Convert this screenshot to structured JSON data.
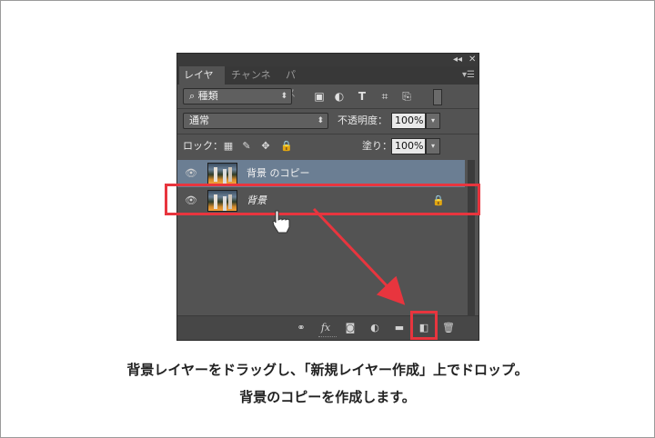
{
  "panel": {
    "top_controls": [
      "◂◂",
      "✕"
    ],
    "tabs": [
      {
        "label": "レイヤー",
        "active": true
      },
      {
        "label": "チャンネル",
        "active": false
      },
      {
        "label": "パス",
        "active": false
      }
    ],
    "menu_icon": "panel-menu-icon",
    "filter": {
      "label": "種類",
      "search_icon": "⌕"
    },
    "filter_icons": [
      "image-filter-icon",
      "adjustment-filter-icon",
      "text-filter-icon",
      "shape-filter-icon",
      "smart-object-filter-icon",
      "filter-toggle-icon"
    ],
    "blend": {
      "mode": "通常",
      "opacity_label": "不透明度：",
      "opacity": "100%"
    },
    "lock": {
      "label": "ロック：",
      "fill_label": "塗り：",
      "fill": "100%"
    },
    "layers": [
      {
        "name": "背景 のコピー",
        "selected": true,
        "italic": false,
        "locked": false
      },
      {
        "name": "背景",
        "selected": false,
        "italic": true,
        "locked": true
      }
    ],
    "footer_icons": [
      "link-icon",
      "fx-icon",
      "mask-icon",
      "adjustment-icon",
      "folder-icon",
      "new-layer-icon",
      "trash-icon"
    ],
    "footer_text": {
      "fx": "fx"
    }
  },
  "caption": {
    "line1": "背景レイヤーをドラッグし、「新規レイヤー作成」上でドロップ。",
    "line2": "背景のコピーを作成します。"
  },
  "colors": {
    "accent_red": "#e8353e",
    "selected_layer": "#6b7e93",
    "panel_bg": "#535353"
  }
}
